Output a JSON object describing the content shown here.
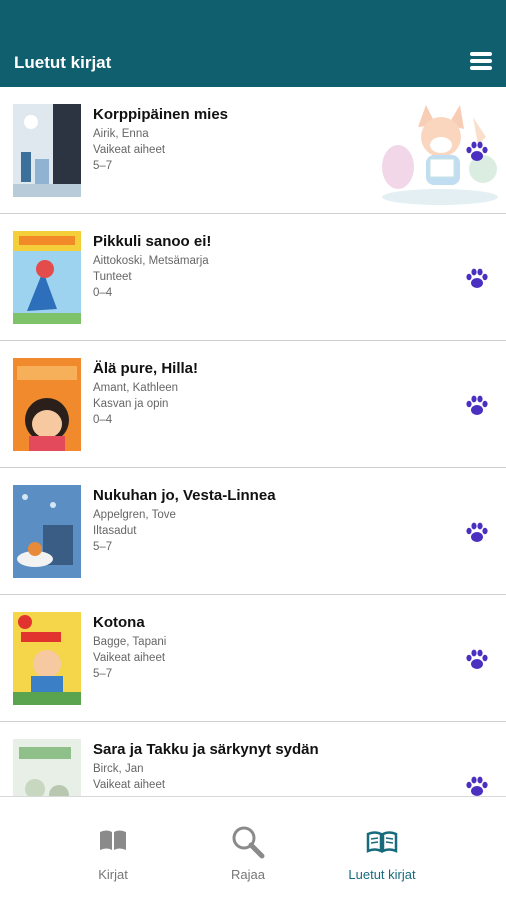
{
  "header": {
    "title": "Luetut kirjat",
    "menu_icon": "hamburger-menu-icon"
  },
  "books": [
    {
      "title": "Korppipäinen mies",
      "author": "Airik, Enna",
      "category": "Vaikeat aiheet",
      "age": "5–7"
    },
    {
      "title": "Pikkuli sanoo ei!",
      "author": "Aittokoski, Metsämarja",
      "category": "Tunteet",
      "age": "0–4"
    },
    {
      "title": "Älä pure, Hilla!",
      "author": "Amant, Kathleen",
      "category": "Kasvan ja opin",
      "age": "0–4"
    },
    {
      "title": "Nukuhan jo, Vesta-Linnea",
      "author": "Appelgren, Tove",
      "category": "Iltasadut",
      "age": "5–7"
    },
    {
      "title": "Kotona",
      "author": "Bagge, Tapani",
      "category": "Vaikeat aiheet",
      "age": "5–7"
    },
    {
      "title": "Sara ja Takku ja särkynyt sydän",
      "author": "Birck, Jan",
      "category": "Vaikeat aiheet",
      "age": ""
    }
  ],
  "tabs": [
    {
      "label": "Kirjat",
      "icon": "book-icon",
      "active": false
    },
    {
      "label": "Rajaa",
      "icon": "search-icon",
      "active": false
    },
    {
      "label": "Luetut kirjat",
      "icon": "reading-book-icon",
      "active": true
    }
  ],
  "colors": {
    "header": "#0f5f6e",
    "paw": "#4a2fc0",
    "active_tab": "#176b7d"
  }
}
